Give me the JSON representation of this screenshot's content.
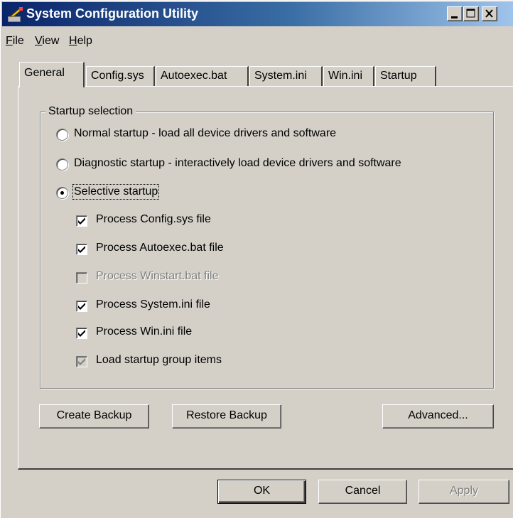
{
  "window": {
    "title": "System Configuration Utility",
    "icon": "system-config-icon"
  },
  "titlebar_buttons": [
    "minimize",
    "maximize",
    "close"
  ],
  "menu": [
    {
      "pre": "",
      "u": "F",
      "post": "ile"
    },
    {
      "pre": "",
      "u": "V",
      "post": "iew"
    },
    {
      "pre": "",
      "u": "H",
      "post": "elp"
    }
  ],
  "tabs": [
    "General",
    "Config.sys",
    "Autoexec.bat",
    "System.ini",
    "Win.ini",
    "Startup"
  ],
  "active_tab": "General",
  "startup_selection": {
    "legend": "Startup selection",
    "options": [
      {
        "label": "Normal startup - load all device drivers and software",
        "selected": false
      },
      {
        "label": "Diagnostic startup - interactively load device drivers and software",
        "selected": false
      },
      {
        "label": "Selective startup",
        "selected": true
      }
    ],
    "checkboxes": [
      {
        "label": "Process Config.sys file",
        "checked": true,
        "enabled": true
      },
      {
        "label": "Process Autoexec.bat file",
        "checked": true,
        "enabled": true
      },
      {
        "label": "Process Winstart.bat file",
        "checked": false,
        "enabled": false
      },
      {
        "label": "Process System.ini file",
        "checked": true,
        "enabled": true
      },
      {
        "label": "Process Win.ini file",
        "checked": true,
        "enabled": true
      },
      {
        "label": "Load startup group items",
        "checked": true,
        "enabled": false
      }
    ]
  },
  "buttons": {
    "create_backup": "Create Backup",
    "restore_backup": "Restore Backup",
    "advanced": "Advanced...",
    "ok": "OK",
    "cancel": "Cancel",
    "apply": "Apply"
  }
}
